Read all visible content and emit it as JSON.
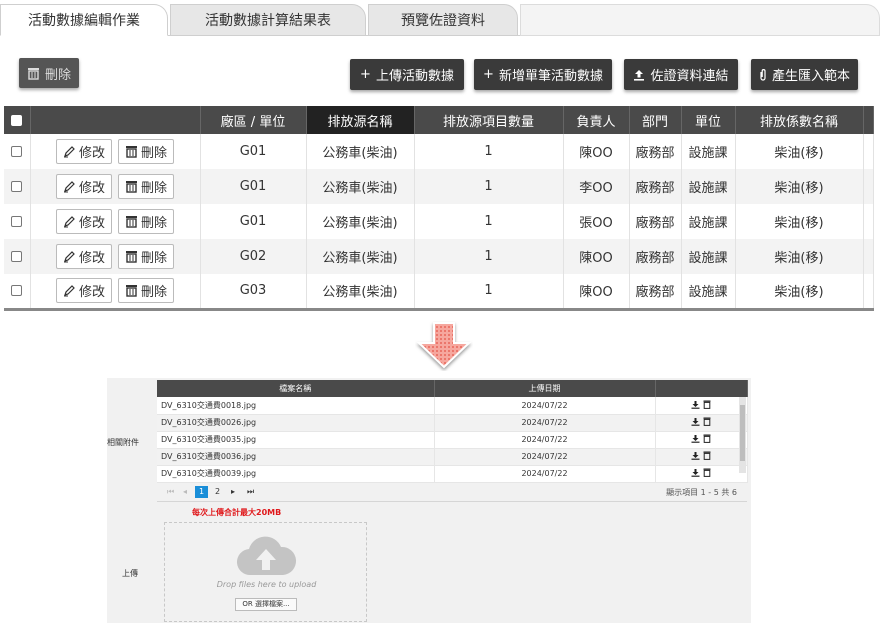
{
  "tabs": [
    {
      "label": "活動數據編輯作業"
    },
    {
      "label": "活動數據計算結果表"
    },
    {
      "label": "預覽佐證資料"
    }
  ],
  "toolbar": {
    "delete_label": "刪除",
    "upload_label": "上傳活動數據",
    "add_label": "新增單筆活動數據",
    "evidence_link_label": "佐證資料連結",
    "template_label": "產生匯入範本"
  },
  "table": {
    "headers": [
      "廠區 / 單位",
      "排放源名稱",
      "排放源項目數量",
      "負責人",
      "部門",
      "單位",
      "排放係數名稱"
    ],
    "edit_label": "修改",
    "delete_label": "刪除",
    "rows": [
      {
        "site": "G01",
        "source": "公務車(柴油)",
        "qty": "1",
        "owner": "陳OO",
        "dept": "廠務部",
        "unit": "設施課",
        "factor": "柴油(移)"
      },
      {
        "site": "G01",
        "source": "公務車(柴油)",
        "qty": "1",
        "owner": "李OO",
        "dept": "廠務部",
        "unit": "設施課",
        "factor": "柴油(移)"
      },
      {
        "site": "G01",
        "source": "公務車(柴油)",
        "qty": "1",
        "owner": "張OO",
        "dept": "廠務部",
        "unit": "設施課",
        "factor": "柴油(移)"
      },
      {
        "site": "G02",
        "source": "公務車(柴油)",
        "qty": "1",
        "owner": "陳OO",
        "dept": "廠務部",
        "unit": "設施課",
        "factor": "柴油(移)"
      },
      {
        "site": "G03",
        "source": "公務車(柴油)",
        "qty": "1",
        "owner": "陳OO",
        "dept": "廠務部",
        "unit": "設施課",
        "factor": "柴油(移)"
      }
    ]
  },
  "attachments": {
    "label": "相關附件",
    "headers": [
      "檔案名稱",
      "上傳日期"
    ],
    "files": [
      {
        "name": "DV_6310交通費0018.jpg",
        "date": "2024/07/22"
      },
      {
        "name": "DV_6310交通費0026.jpg",
        "date": "2024/07/22"
      },
      {
        "name": "DV_6310交通費0035.jpg",
        "date": "2024/07/22"
      },
      {
        "name": "DV_6310交通費0036.jpg",
        "date": "2024/07/22"
      },
      {
        "name": "DV_6310交通費0039.jpg",
        "date": "2024/07/22"
      }
    ],
    "pager": {
      "page1": "1",
      "page2": "2",
      "summary": "顯示項目 1 - 5 共 6"
    }
  },
  "upload": {
    "label": "上傳",
    "limit_text": "每次上傳合計最大20MB",
    "drop_hint": "Drop files here to upload",
    "select_button": "OR 選擇檔案..."
  },
  "colors": {
    "header_bg": "#4a4a4a",
    "button_bg": "#3a3a3a",
    "limit_text": "#e0181b",
    "pager_active": "#1a8ed8",
    "arrow": "#f08a80"
  }
}
